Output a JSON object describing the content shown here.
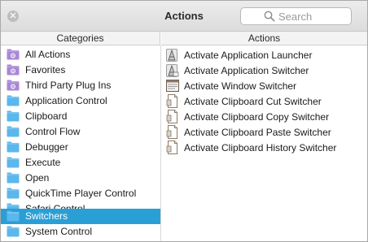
{
  "window": {
    "title": "Actions",
    "close_glyph": "✕"
  },
  "search": {
    "placeholder": "Search",
    "value": "",
    "icon": "magnifier-icon"
  },
  "columns": {
    "categories_header": "Categories",
    "actions_header": "Actions"
  },
  "categories": [
    {
      "label": "All Actions",
      "icon": "smart-folder-icon",
      "selected": false
    },
    {
      "label": "Favorites",
      "icon": "smart-folder-icon",
      "selected": false
    },
    {
      "label": "Third Party Plug Ins",
      "icon": "smart-folder-icon",
      "selected": false
    },
    {
      "label": "Application Control",
      "icon": "folder-icon",
      "selected": false
    },
    {
      "label": "Clipboard",
      "icon": "folder-icon",
      "selected": false
    },
    {
      "label": "Control Flow",
      "icon": "folder-icon",
      "selected": false
    },
    {
      "label": "Debugger",
      "icon": "folder-icon",
      "selected": false
    },
    {
      "label": "Execute",
      "icon": "folder-icon",
      "selected": false
    },
    {
      "label": "Open",
      "icon": "folder-icon",
      "selected": false
    },
    {
      "label": "QuickTime Player Control",
      "icon": "folder-icon",
      "selected": false
    },
    {
      "label": "Safari Control",
      "icon": "folder-icon",
      "selected": false
    },
    {
      "label": "Switchers",
      "icon": "folder-icon",
      "selected": true
    },
    {
      "label": "System Control",
      "icon": "folder-icon",
      "selected": false
    }
  ],
  "actions": [
    {
      "label": "Activate Application Launcher",
      "icon": "app-launcher-icon"
    },
    {
      "label": "Activate Application Switcher",
      "icon": "app-switcher-icon"
    },
    {
      "label": "Activate Window Switcher",
      "icon": "window-switcher-icon"
    },
    {
      "label": "Activate Clipboard Cut Switcher",
      "icon": "clipboard-document-icon"
    },
    {
      "label": "Activate Clipboard Copy Switcher",
      "icon": "clipboard-document-icon"
    },
    {
      "label": "Activate Clipboard Paste Switcher",
      "icon": "clipboard-document-icon"
    },
    {
      "label": "Activate Clipboard History Switcher",
      "icon": "clipboard-document-icon"
    }
  ],
  "colors": {
    "selection": "#2a9fd6",
    "folder_blue": "#5bb7ec",
    "smart_folder_purple": "#a987d6"
  }
}
